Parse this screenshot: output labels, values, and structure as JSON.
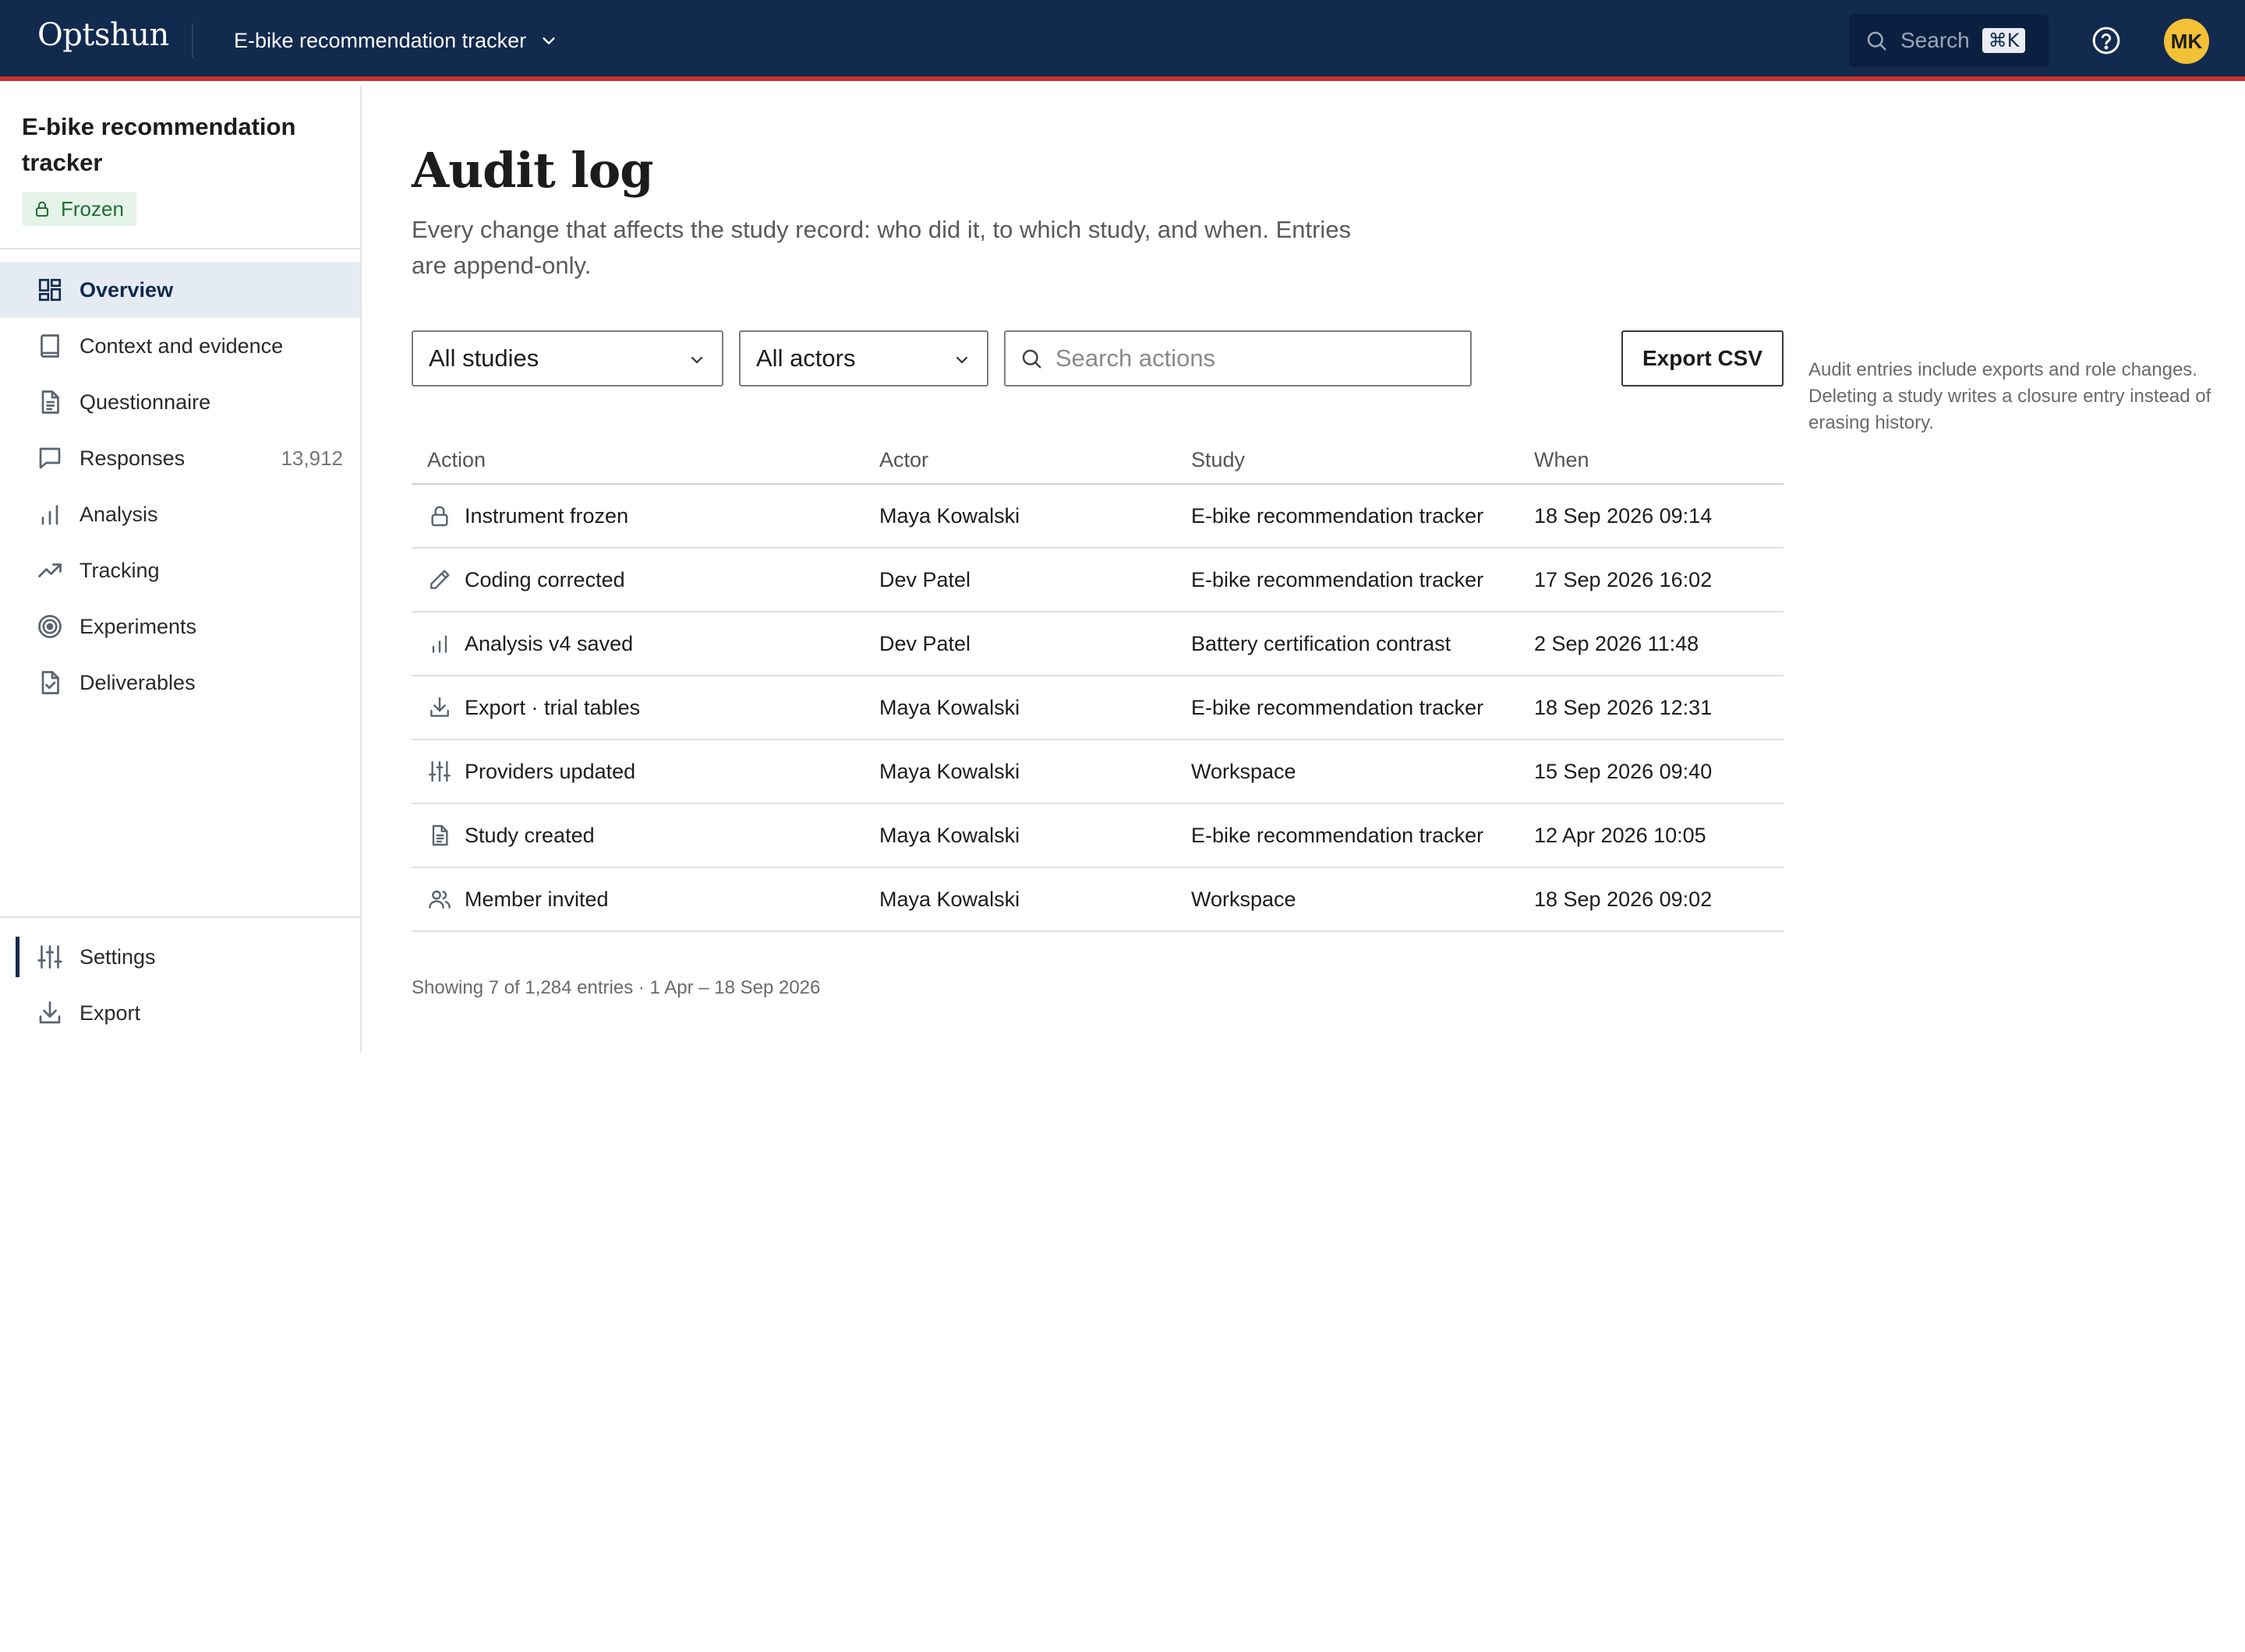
{
  "topbar": {
    "brand": "Optshun",
    "study_name": "E-bike recommendation tracker",
    "search_label": "Search",
    "search_shortcut": "⌘K",
    "avatar_initials": "MK",
    "accent_color": "#c8322c",
    "bg_color": "#112a4e"
  },
  "sidebar": {
    "study_title": "E-bike recommendation tracker",
    "status_badge": "Frozen",
    "items": [
      {
        "label": "Overview",
        "icon": "grid-icon",
        "count": ""
      },
      {
        "label": "Context and evidence",
        "icon": "book-icon",
        "count": ""
      },
      {
        "label": "Questionnaire",
        "icon": "document-icon",
        "count": ""
      },
      {
        "label": "Responses",
        "icon": "chat-icon",
        "count": "13,912"
      },
      {
        "label": "Analysis",
        "icon": "bar-chart-icon",
        "count": ""
      },
      {
        "label": "Tracking",
        "icon": "trend-icon",
        "count": ""
      },
      {
        "label": "Experiments",
        "icon": "target-icon",
        "count": ""
      },
      {
        "label": "Deliverables",
        "icon": "file-check-icon",
        "count": ""
      }
    ],
    "bottom_items": [
      {
        "label": "Settings",
        "icon": "sliders-icon"
      },
      {
        "label": "Export",
        "icon": "download-icon"
      }
    ]
  },
  "main": {
    "title": "Audit log",
    "description": "Every change that affects the study record: who did it, to which study, and when. Entries are append-only.",
    "filters": {
      "studies_selected": "All studies",
      "actors_selected": "All actors",
      "search_placeholder": "Search actions",
      "search_value": ""
    },
    "export_label": "Export CSV",
    "side_note": "Audit entries include exports and role changes. Deleting a study writes a closure entry instead of erasing history.",
    "table": {
      "columns": [
        "Action",
        "Actor",
        "Study",
        "When"
      ],
      "rows": [
        {
          "icon": "lock-icon",
          "action": "Instrument frozen",
          "actor": "Maya Kowalski",
          "study": "E-bike recommendation tracker",
          "when": "18 Sep 2026 09:14"
        },
        {
          "icon": "pencil-icon",
          "action": "Coding corrected",
          "actor": "Dev Patel",
          "study": "E-bike recommendation tracker",
          "when": "17 Sep 2026 16:02"
        },
        {
          "icon": "bar-chart-icon",
          "action": "Analysis v4 saved",
          "actor": "Dev Patel",
          "study": "Battery certification contrast",
          "when": "2 Sep 2026 11:48"
        },
        {
          "icon": "download-icon",
          "action": "Export · trial tables",
          "actor": "Maya Kowalski",
          "study": "E-bike recommendation tracker",
          "when": "18 Sep 2026 12:31"
        },
        {
          "icon": "sliders-icon",
          "action": "Providers updated",
          "actor": "Maya Kowalski",
          "study": "Workspace",
          "when": "15 Sep 2026 09:40"
        },
        {
          "icon": "document-icon",
          "action": "Study created",
          "actor": "Maya Kowalski",
          "study": "E-bike recommendation tracker",
          "when": "12 Apr 2026 10:05"
        },
        {
          "icon": "users-icon",
          "action": "Member invited",
          "actor": "Maya Kowalski",
          "study": "Workspace",
          "when": "18 Sep 2026 09:02"
        }
      ]
    },
    "footer": "Showing 7 of 1,284 entries · 1 Apr – 18 Sep 2026"
  }
}
